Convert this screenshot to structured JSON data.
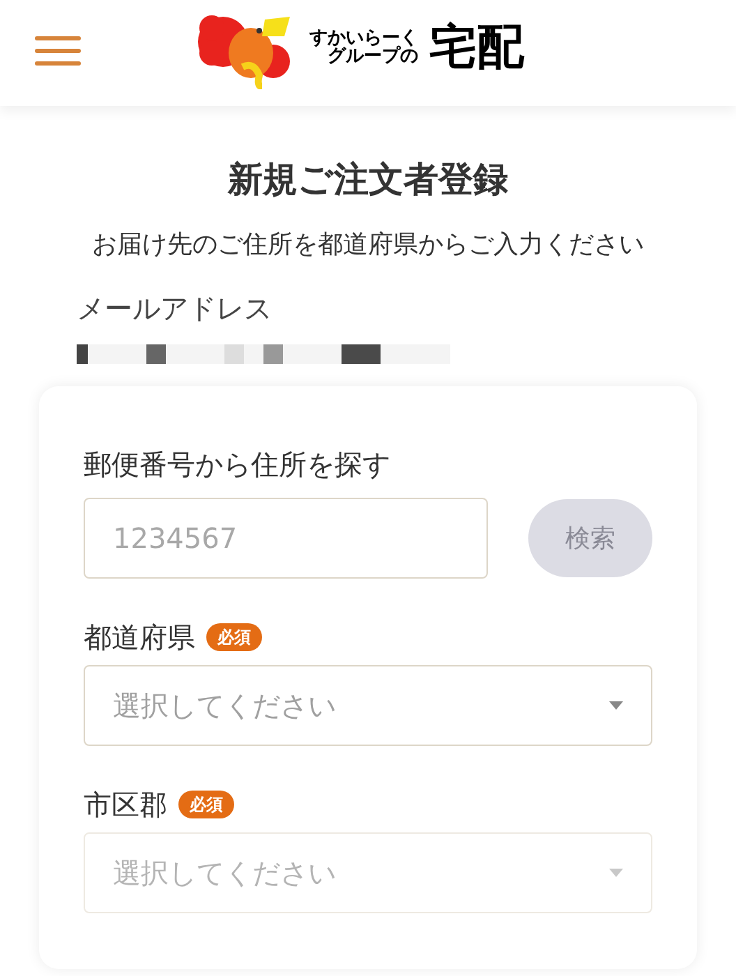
{
  "header": {
    "logo_lines": [
      "すかいらーく",
      "グループの"
    ],
    "logo_main": "宅配"
  },
  "title": "新規ご注文者登録",
  "subtitle": "お届け先のご住所を都道府県からご入力ください",
  "email": {
    "label": "メールアドレス"
  },
  "postal": {
    "label": "郵便番号から住所を探す",
    "placeholder": "1234567",
    "button": "検索",
    "button_disabled": true
  },
  "fields": [
    {
      "label": "都道府県",
      "badge": "必須",
      "placeholder": "選択してください",
      "disabled": false
    },
    {
      "label": "市区郡",
      "badge": "必須",
      "placeholder": "選択してください",
      "disabled": true
    }
  ]
}
